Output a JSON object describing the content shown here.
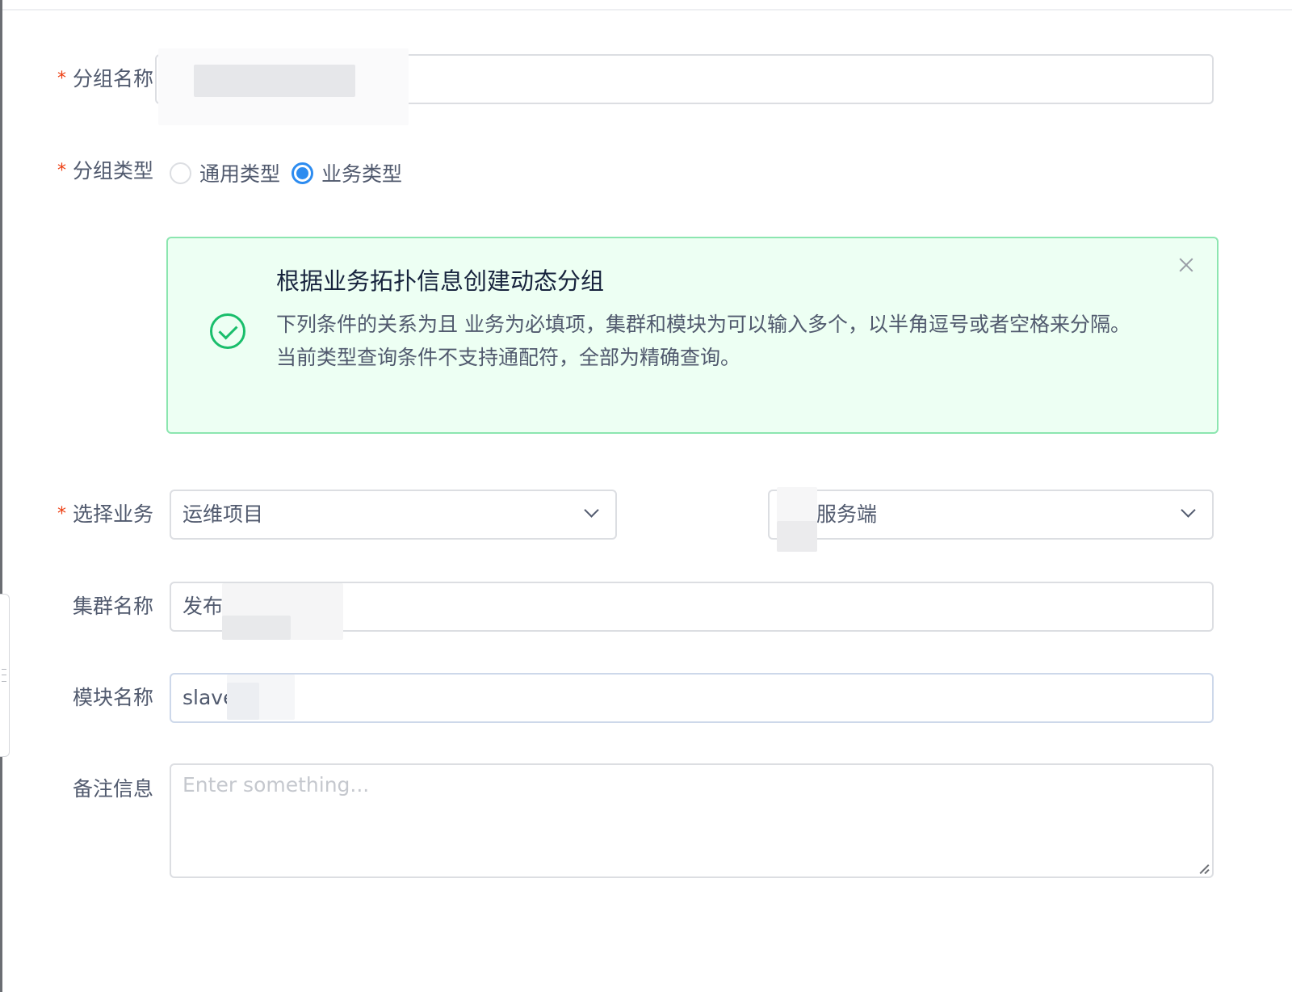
{
  "form": {
    "group_name": {
      "label": "分组名称",
      "required_mark": "*",
      "value": ""
    },
    "group_type": {
      "label": "分组类型",
      "required_mark": "*",
      "options": [
        "通用类型",
        "业务类型"
      ],
      "selected": "业务类型"
    },
    "alert": {
      "title": "根据业务拓扑信息创建动态分组",
      "line1": "下列条件的关系为且 业务为必填项，集群和模块为可以输入多个，以半角逗号或者空格来分隔。",
      "line2": "当前类型查询条件不支持通配符，全部为精确查询。",
      "icon": "check-circle-icon",
      "close_icon": "close-icon"
    },
    "business": {
      "label": "选择业务",
      "required_mark": "*",
      "select1_value": "运维项目",
      "select2_value": "服务端"
    },
    "cluster": {
      "label": "集群名称",
      "value": "发布"
    },
    "module": {
      "label": "模块名称",
      "value": "slave"
    },
    "remark": {
      "label": "备注信息",
      "placeholder": "Enter something..."
    }
  },
  "colors": {
    "required": "#ed4014",
    "primary": "#2d8cf0",
    "success": "#19be6b",
    "alert_bg": "#edfff3",
    "alert_border": "#8ce6b0"
  }
}
